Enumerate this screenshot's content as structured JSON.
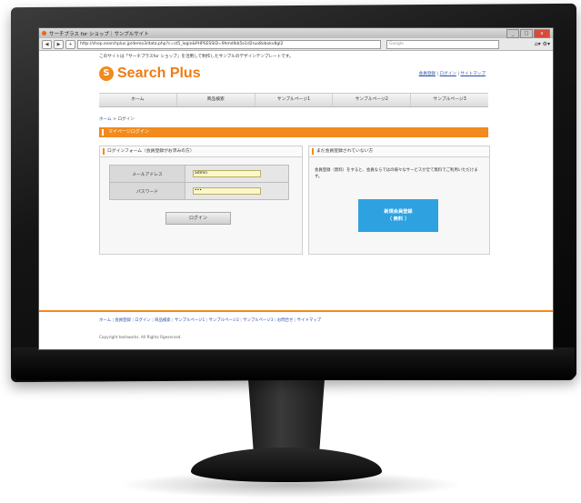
{
  "browser": {
    "window_title": "サーチプラス for ショップ｜サンプルサイト",
    "address": "http://shop.searchplus.jp/demo3/data.php?c=st5_login&PHPSESSID=9hmdlkb5o1d2ruo8obokv8gl2",
    "search_placeholder": "Google",
    "back_label": "◀",
    "forward_label": "▶",
    "add_label": "+",
    "nav_right_label": "⌂▾ ⚙▾",
    "win_min": "_",
    "win_max": "□",
    "win_close": "x"
  },
  "site": {
    "notice": "このサイトは「サーチプラスfor ショップ」を活用して制作したサンプルのデザインテンプレートです。",
    "logo_mark": "S",
    "logo_text": "Search Plus",
    "top_links": [
      "会員登録",
      "ログイン",
      "サイトマップ"
    ],
    "top_sep": "|",
    "gnav": [
      "ホーム",
      "商品検索",
      "サンプルページ1",
      "サンプルページ2",
      "サンプルページ3"
    ],
    "breadcrumb_home": "ホーム",
    "breadcrumb_sep": ">",
    "breadcrumb_current": "ログイン",
    "ribbon_title": "マイページログイン"
  },
  "login_form": {
    "heading": "ログインフォーム（会員登録がお済みの方）",
    "email_label": "メールアドレス",
    "email_value": "admin",
    "password_label": "パスワード",
    "password_value": "•••",
    "submit_label": "ログイン"
  },
  "register": {
    "heading": "まだ会員登録されていない方",
    "text": "会員登録（無料）をすると、会員ならではの様々なサービスが全て無料でご利用いただけます。",
    "button_line1": "新規会員登録",
    "button_line2": "（ 無料 ）"
  },
  "footer": {
    "links": [
      "ホーム",
      "会員登録",
      "ログイン",
      "商品検索",
      "サンプルページ1",
      "サンプルページ2",
      "サンプルページ3",
      "お問合せ",
      "サイトマップ"
    ],
    "copyright": "Copyright texhworks. All Rights Rgeserved."
  },
  "colors": {
    "accent": "#f28a1c",
    "register_button": "#2ea2e0"
  }
}
